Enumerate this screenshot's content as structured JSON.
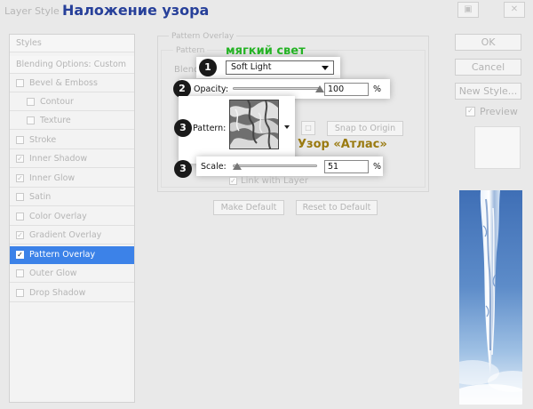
{
  "title_bar": {
    "app_title": "Layer Style",
    "tutorial_title": "Наложение узора"
  },
  "styles_panel": {
    "header": "Styles",
    "blending_options": "Blending Options: Custom",
    "items": [
      {
        "label": "Bevel & Emboss",
        "checked": false
      },
      {
        "label": "Contour",
        "checked": false,
        "sub": true
      },
      {
        "label": "Texture",
        "checked": false,
        "sub": true
      },
      {
        "label": "Stroke",
        "checked": false
      },
      {
        "label": "Inner Shadow",
        "checked": true
      },
      {
        "label": "Inner Glow",
        "checked": true
      },
      {
        "label": "Satin",
        "checked": false
      },
      {
        "label": "Color Overlay",
        "checked": false
      },
      {
        "label": "Gradient Overlay",
        "checked": true
      },
      {
        "label": "Pattern Overlay",
        "checked": true,
        "selected": true
      },
      {
        "label": "Outer Glow",
        "checked": false
      },
      {
        "label": "Drop Shadow",
        "checked": false
      }
    ]
  },
  "pattern_overlay": {
    "group_title": "Pattern Overlay",
    "subgroup_title": "Pattern",
    "blend_mode_label": "Blend Mode:",
    "blend_mode_value": "Soft Light",
    "opacity_label": "Opacity:",
    "opacity_value": "100",
    "opacity_unit": "%",
    "opacity_fraction": 1.0,
    "pattern_label": "Pattern:",
    "snap_to_origin": "Snap to Origin",
    "scale_label": "Scale:",
    "scale_value": "51",
    "scale_unit": "%",
    "scale_fraction": 0.05,
    "link_with_layer_label": "Link with Layer",
    "link_with_layer_checked": true,
    "make_default": "Make Default",
    "reset_to_default": "Reset to Default"
  },
  "annotations": {
    "step1": "1",
    "step2": "2",
    "step3a": "3",
    "step3b": "3",
    "blend_note": "мягкий свет",
    "pattern_note": "Узор «Атлас»",
    "blend_note_color": "#25b325",
    "pattern_note_color": "#9a7a10"
  },
  "right_buttons": {
    "ok": "OK",
    "cancel": "Cancel",
    "new_style": "New Style...",
    "preview_label": "Preview",
    "preview_checked": true
  },
  "colors": {
    "selection": "#3c82e8",
    "title_accent": "#27409a"
  }
}
